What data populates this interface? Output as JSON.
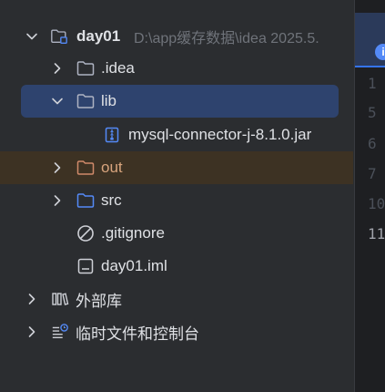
{
  "project": {
    "name": "day01",
    "path": "D:\\app缓存数据\\idea 2025.5."
  },
  "tree": {
    "idea": ".idea",
    "lib": "lib",
    "jar": "mysql-connector-j-8.1.0.jar",
    "out": "out",
    "src": "src",
    "gitignore": ".gitignore",
    "iml": "day01.iml",
    "external_libraries": "外部库",
    "scratches": "临时文件和控制台"
  },
  "editor": {
    "tab_badge": "i",
    "line_numbers": [
      "1",
      "5",
      "6",
      "7",
      "10",
      "11"
    ]
  },
  "colors": {
    "background": "#2b2d30",
    "selection": "#2e436e",
    "excluded_row": "#3d3223",
    "folder_icon": "#aeb3c2",
    "source_folder_icon": "#548af7",
    "excluded_folder_icon": "#d08a6a",
    "accent": "#548af7"
  }
}
